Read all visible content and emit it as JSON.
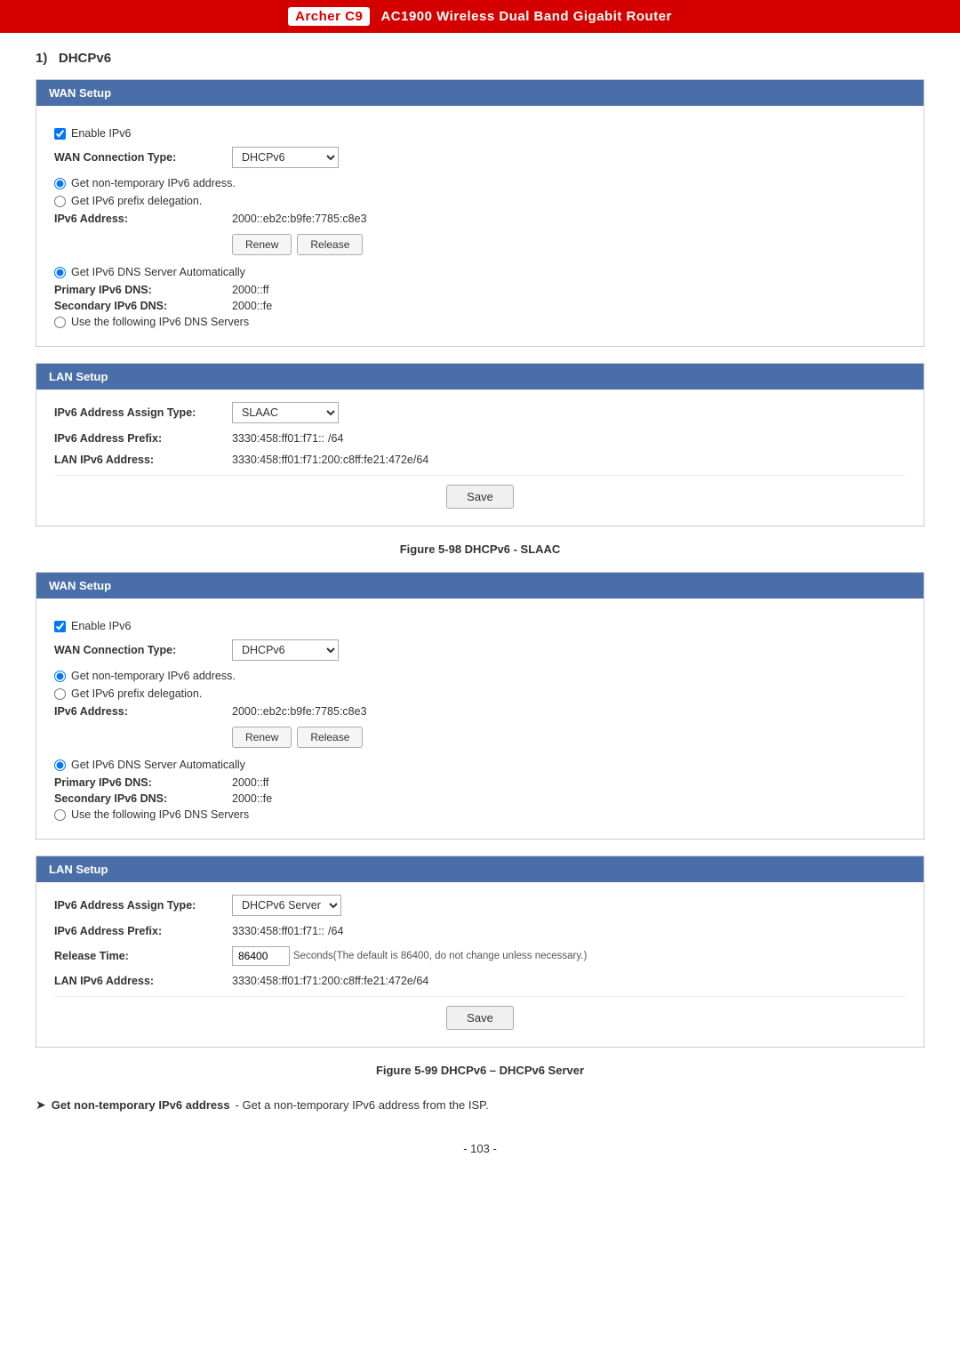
{
  "header": {
    "model": "Archer C9",
    "product": "AC1900 Wireless Dual Band Gigabit Router"
  },
  "section": {
    "number": "1)",
    "title": "DHCPv6"
  },
  "figure1": {
    "caption": "Figure 5-98 DHCPv6 - SLAAC"
  },
  "figure2": {
    "caption": "Figure 5-99 DHCPv6 – DHCPv6 Server"
  },
  "wan_setup_label": "WAN Setup",
  "lan_setup_label": "LAN Setup",
  "enable_ipv6_label": "Enable IPv6",
  "wan_connection_type_label": "WAN Connection Type:",
  "wan_connection_type_value": "DHCPv6",
  "get_non_temporary_label": "Get non-temporary IPv6 address.",
  "get_prefix_delegation_label": "Get IPv6 prefix delegation.",
  "ipv6_address_label": "IPv6 Address:",
  "ipv6_address_value": "2000::eb2c:b9fe:7785:c8e3",
  "renew_label": "Renew",
  "release_label": "Release",
  "get_ipv6_dns_auto_label": "Get IPv6 DNS Server Automatically",
  "primary_ipv6_dns_label": "Primary IPv6 DNS:",
  "primary_ipv6_dns_value": "2000::ff",
  "secondary_ipv6_dns_label": "Secondary IPv6 DNS:",
  "secondary_ipv6_dns_value": "2000::fe",
  "use_following_dns_label": "Use the following IPv6 DNS Servers",
  "ipv6_assign_type_label": "IPv6 Address Assign Type:",
  "ipv6_assign_type_slaac": "SLAAC",
  "ipv6_assign_type_dhcpv6": "DHCPv6 Server",
  "ipv6_prefix_label": "IPv6 Address Prefix:",
  "ipv6_prefix_value": "3330:458:ff01:f71::",
  "ipv6_prefix_suffix": "/64",
  "lan_ipv6_address_label": "LAN IPv6 Address:",
  "lan_ipv6_address_value": "3330:458:ff01:f71:200:c8ff:fe21:472e/64",
  "save_label": "Save",
  "release_time_label": "Release Time:",
  "release_time_value": "86400",
  "release_time_hint": "Seconds(The default is 86400, do not change unless necessary.)",
  "bottom_note_arrow": "➤",
  "bottom_note_bold": "Get non-temporary IPv6 address",
  "bottom_note_text": "- Get a non-temporary IPv6 address from the ISP.",
  "page_number": "- 103 -"
}
